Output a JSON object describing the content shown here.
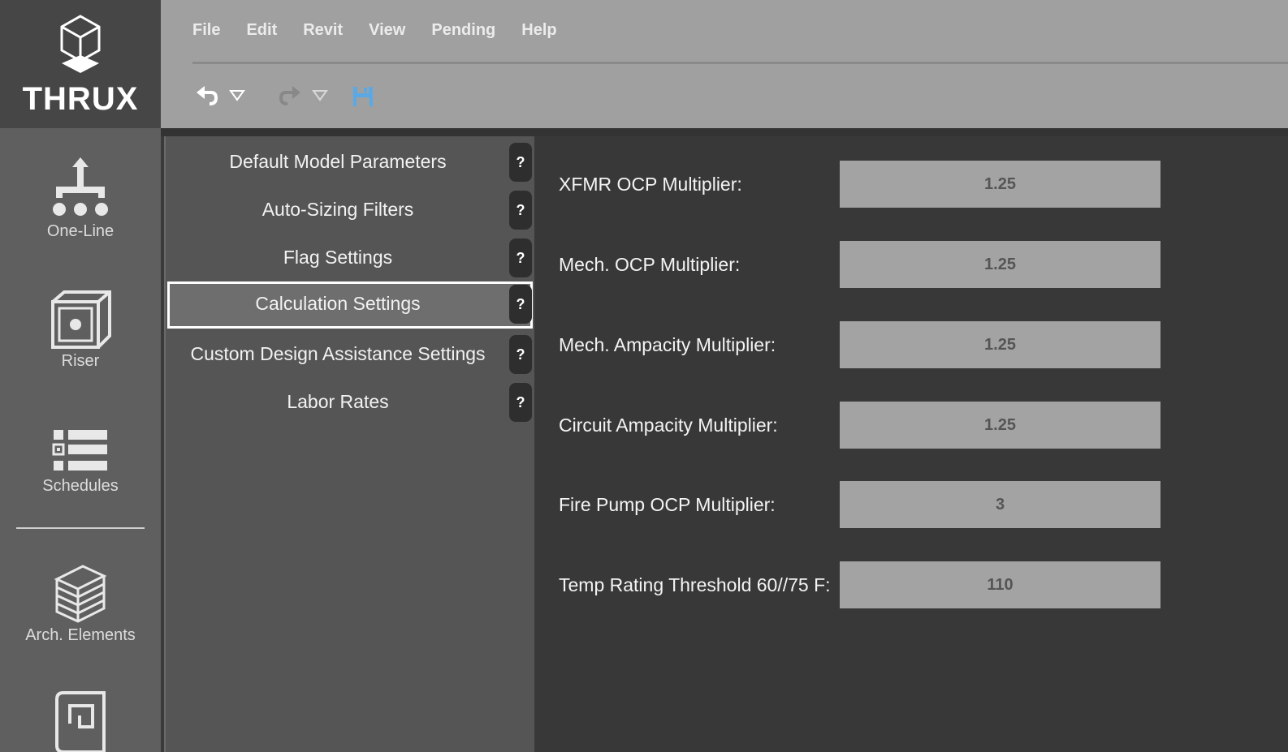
{
  "app": {
    "logo_text": "THRUX"
  },
  "rail": {
    "items": [
      {
        "label": "One-Line"
      },
      {
        "label": "Riser"
      },
      {
        "label": "Schedules"
      },
      {
        "label": "Arch. Elements"
      }
    ]
  },
  "menubar": {
    "items": [
      "File",
      "Edit",
      "Revit",
      "View",
      "Pending",
      "Help"
    ]
  },
  "settings_nav": {
    "items": [
      {
        "label": "Default Model Parameters",
        "help": "?"
      },
      {
        "label": "Auto-Sizing Filters",
        "help": "?"
      },
      {
        "label": "Flag Settings",
        "help": "?"
      },
      {
        "label": "Calculation Settings",
        "help": "?"
      },
      {
        "label": "Custom Design Assistance Settings",
        "help": "?"
      },
      {
        "label": "Labor Rates",
        "help": "?"
      }
    ],
    "selected": "Calculation Settings"
  },
  "calc_settings": {
    "fields": [
      {
        "label": "XFMR OCP Multiplier:",
        "value": "1.25"
      },
      {
        "label": "Mech. OCP Multiplier:",
        "value": "1.25"
      },
      {
        "label": "Mech. Ampacity Multiplier:",
        "value": "1.25"
      },
      {
        "label": "Circuit Ampacity Multiplier:",
        "value": "1.25"
      },
      {
        "label": "Fire Pump OCP Multiplier:",
        "value": "3"
      },
      {
        "label": "Temp Rating Threshold 60//75 F:",
        "value": "110"
      }
    ]
  },
  "colors": {
    "save_icon": "#5aa9e6",
    "active_outline": "#ffffff"
  }
}
